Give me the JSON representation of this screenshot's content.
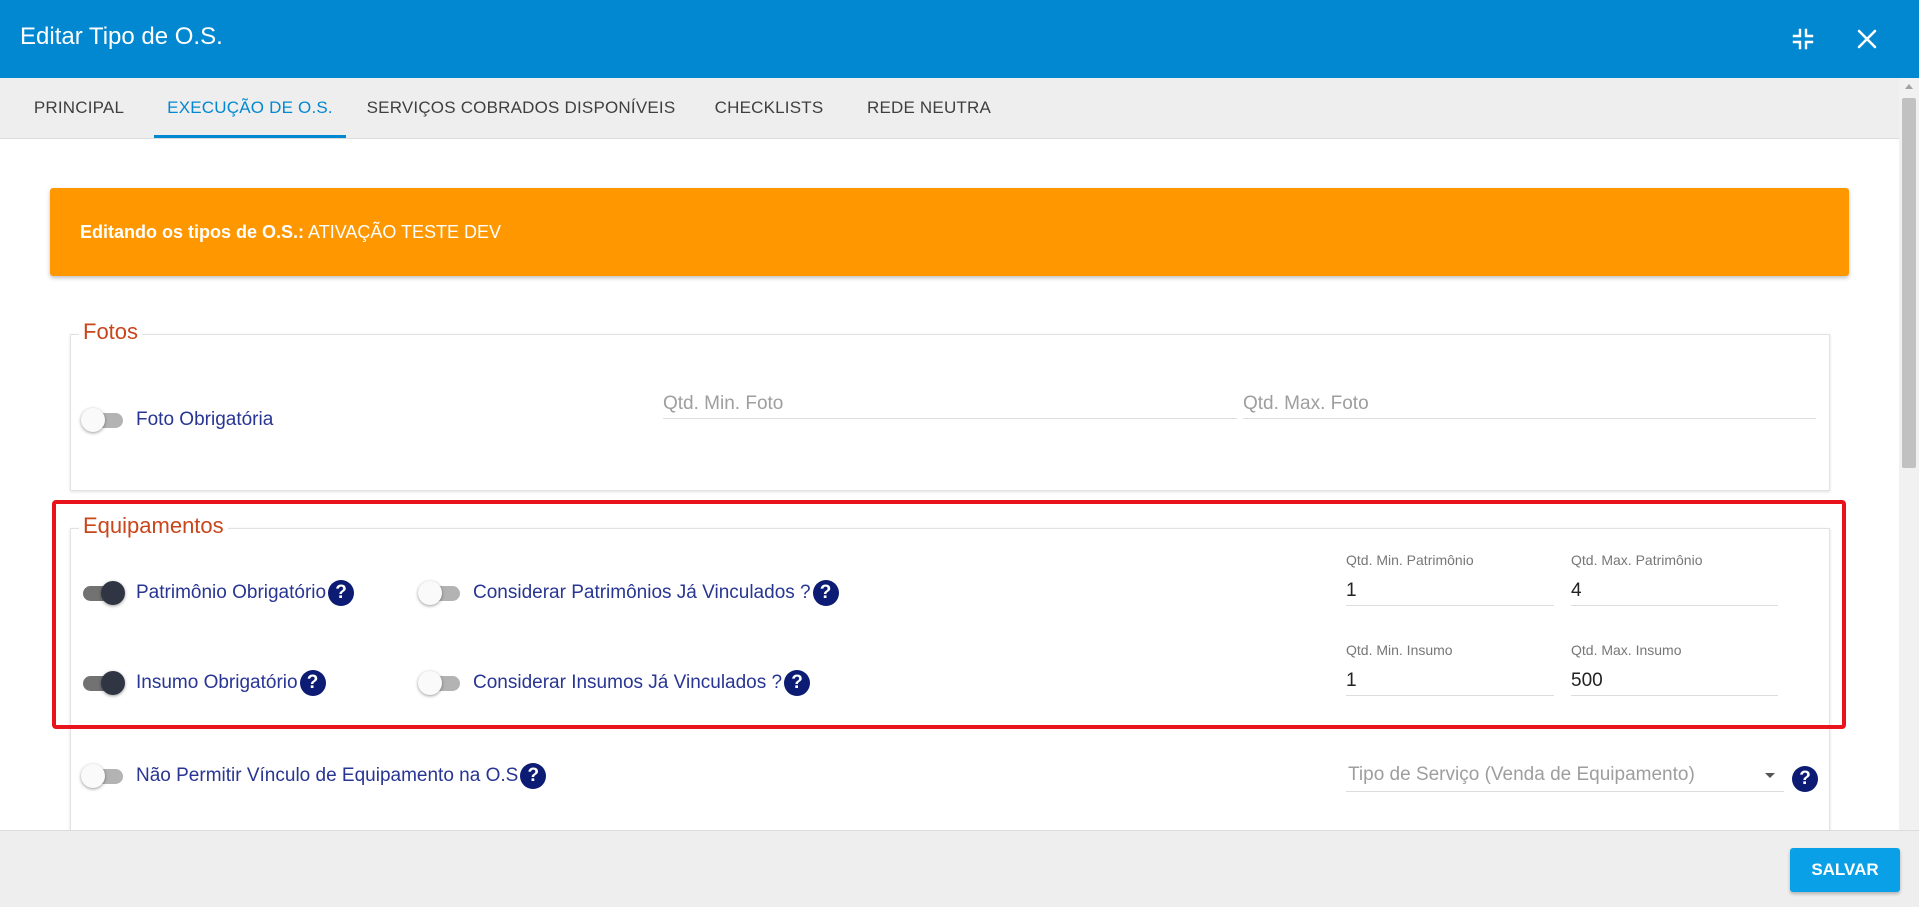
{
  "dialog": {
    "title": "Editar Tipo de O.S.",
    "minimize_icon": "collapse-arrows-icon",
    "close_icon": "close-icon"
  },
  "tabs": [
    {
      "label": "PRINCIPAL",
      "active": false
    },
    {
      "label": "EXECUÇÃO DE O.S.",
      "active": true
    },
    {
      "label": "SERVIÇOS COBRADOS DISPONÍVEIS",
      "active": false
    },
    {
      "label": "CHECKLISTS",
      "active": false
    },
    {
      "label": "REDE NEUTRA",
      "active": false
    }
  ],
  "banner": {
    "prefix": "Editando os tipos de O.S.:",
    "value": " ATIVAÇÃO TESTE DEV",
    "color": "#ff9800"
  },
  "fotos": {
    "legend": "Fotos",
    "toggle_label": "Foto Obrigatória",
    "toggle_on": false,
    "min_placeholder": "Qtd. Min. Foto",
    "max_placeholder": "Qtd. Max. Foto"
  },
  "equipamentos": {
    "legend": "Equipamentos",
    "patrimonio": {
      "label": "Patrimônio Obrigatório",
      "on": true,
      "considerar_label": "Considerar Patrimônios Já Vinculados ?",
      "considerar_on": false,
      "min_label": "Qtd. Min. Patrimônio",
      "min_value": "1",
      "max_label": "Qtd. Max. Patrimônio",
      "max_value": "4"
    },
    "insumo": {
      "label": "Insumo Obrigatório",
      "on": true,
      "considerar_label": "Considerar Insumos Já Vinculados ?",
      "considerar_on": false,
      "min_label": "Qtd. Min. Insumo",
      "min_value": "1",
      "max_label": "Qtd. Max. Insumo",
      "max_value": "500"
    },
    "nao_permitir": {
      "label": "Não Permitir Vínculo de Equipamento na O.S",
      "on": false
    },
    "tipo_servico_placeholder": "Tipo de Serviço (Venda de Equipamento)"
  },
  "help_glyph": "?",
  "footer": {
    "save_label": "SALVAR"
  },
  "colors": {
    "header": "#0288d1",
    "accent_tab": "#0288d1",
    "legend": "#c8461c",
    "highlight": "#e8131b",
    "save_button": "#0aa0e8"
  }
}
